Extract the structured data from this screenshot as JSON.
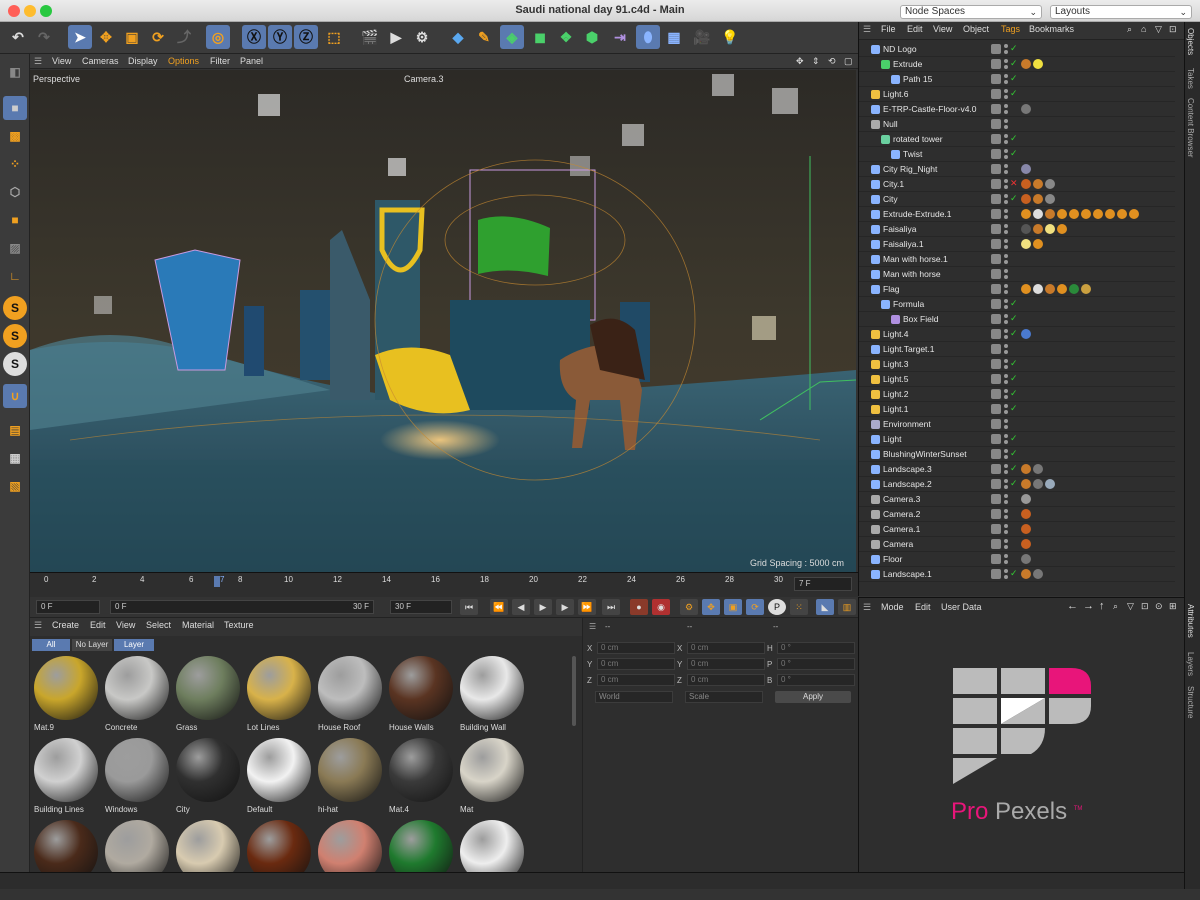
{
  "window": {
    "title": "Saudi national day 91.c4d - Main",
    "node_spaces": "Node Spaces",
    "layouts": "Layouts"
  },
  "viewport": {
    "menu": [
      "View",
      "Cameras",
      "Display",
      "Options",
      "Filter",
      "Panel"
    ],
    "label": "Perspective",
    "camera": "Camera.3",
    "grid": "Grid Spacing : 5000 cm"
  },
  "timeline": {
    "ticks": [
      "0",
      "2",
      "4",
      "6",
      "7",
      "8",
      "10",
      "12",
      "14",
      "16",
      "18",
      "20",
      "22",
      "24",
      "26",
      "28",
      "30"
    ],
    "current": "7 F",
    "start": "0 F",
    "range_start": "0 F",
    "range_end": "30 F",
    "end": "30 F"
  },
  "materials": {
    "menu": [
      "Create",
      "Edit",
      "View",
      "Select",
      "Material",
      "Texture"
    ],
    "tabs": [
      "All",
      "No Layer",
      "Layer"
    ],
    "items": [
      {
        "name": "Mat.9",
        "color": "#c9a62b"
      },
      {
        "name": "Concrete",
        "color": "#c8c8c6"
      },
      {
        "name": "Grass",
        "color": "#6e7e5e"
      },
      {
        "name": "Lot Lines",
        "color": "#d8b24a"
      },
      {
        "name": "House Roof",
        "color": "#bdbdbd"
      },
      {
        "name": "House Walls",
        "color": "#5a3422"
      },
      {
        "name": "Building Wall",
        "color": "#e8e8e8"
      },
      {
        "name": "Building Lines",
        "color": "#d0d0d0"
      },
      {
        "name": "Windows",
        "color": "#9a9a9a"
      },
      {
        "name": "City",
        "color": "#303030"
      },
      {
        "name": "Default",
        "color": "#f2f2f2"
      },
      {
        "name": "hi-hat",
        "color": "#8a7a55"
      },
      {
        "name": "Mat.4",
        "color": "#3a3a3a"
      },
      {
        "name": "Mat",
        "color": "#d8d4c8"
      },
      {
        "name": "",
        "color": "#4a2a1a"
      },
      {
        "name": "",
        "color": "#b0aaa0"
      },
      {
        "name": "",
        "color": "#d8cbb0"
      },
      {
        "name": "",
        "color": "#6a2a10"
      },
      {
        "name": "",
        "color": "#d08070"
      },
      {
        "name": "",
        "color": "#1f7a2e"
      },
      {
        "name": "",
        "color": "#eeeeee"
      }
    ]
  },
  "coords": {
    "dash": "--",
    "rows": [
      {
        "a": "X",
        "av": "0 cm",
        "b": "X",
        "bv": "0 cm",
        "c": "H",
        "cv": "0 °"
      },
      {
        "a": "Y",
        "av": "0 cm",
        "b": "Y",
        "bv": "0 cm",
        "c": "P",
        "cv": "0 °"
      },
      {
        "a": "Z",
        "av": "0 cm",
        "b": "Z",
        "bv": "0 cm",
        "c": "B",
        "cv": "0 °"
      }
    ],
    "world": "World",
    "scale": "Scale",
    "apply": "Apply"
  },
  "objects": {
    "menu": [
      "File",
      "Edit",
      "View",
      "Object",
      "Tags",
      "Bookmarks"
    ],
    "rows": [
      {
        "name": "ND Logo",
        "indent": 0,
        "icon": "#8ab4ff",
        "state": "ok",
        "tags": []
      },
      {
        "name": "Extrude",
        "indent": 1,
        "icon": "#4ad06a",
        "state": "ok",
        "tags": [
          "#c87a2a",
          "#f0e040"
        ]
      },
      {
        "name": "Path 15",
        "indent": 2,
        "icon": "#8ab4ff",
        "state": "ok",
        "tags": []
      },
      {
        "name": "Light.6",
        "indent": 0,
        "icon": "#f0c040",
        "state": "ok",
        "tags": []
      },
      {
        "name": "E-TRP-Castle-Floor-v4.0",
        "indent": 0,
        "icon": "#8ab4ff",
        "state": "",
        "tags": [
          "#777"
        ]
      },
      {
        "name": "Null",
        "indent": 0,
        "icon": "#aaa",
        "state": "",
        "tags": []
      },
      {
        "name": "rotated tower",
        "indent": 1,
        "icon": "#6ad0a0",
        "state": "ok",
        "tags": []
      },
      {
        "name": "Twist",
        "indent": 2,
        "icon": "#8ab4ff",
        "state": "ok",
        "tags": []
      },
      {
        "name": "City Rig_Night",
        "indent": 0,
        "icon": "#8ab4ff",
        "state": "",
        "tags": [
          "#88a"
        ]
      },
      {
        "name": "City.1",
        "indent": 0,
        "icon": "#8ab4ff",
        "state": "x",
        "tags": [
          "#c86020",
          "#c87a2a",
          "#888"
        ]
      },
      {
        "name": "City",
        "indent": 0,
        "icon": "#8ab4ff",
        "state": "ok",
        "tags": [
          "#c86020",
          "#c87a2a",
          "#888"
        ]
      },
      {
        "name": "Extrude-Extrude.1",
        "indent": 0,
        "icon": "#8ab4ff",
        "state": "",
        "tags": [
          "#e09020",
          "#ddd",
          "#c87a2a",
          "#e09020",
          "#e09020",
          "#e09020",
          "#e09020",
          "#e09020",
          "#e09020",
          "#e09020"
        ]
      },
      {
        "name": "Faisaliya",
        "indent": 0,
        "icon": "#8ab4ff",
        "state": "",
        "tags": [
          "#555",
          "#c87a2a",
          "#f0e080",
          "#e09020"
        ]
      },
      {
        "name": "Faisaliya.1",
        "indent": 0,
        "icon": "#8ab4ff",
        "state": "",
        "tags": [
          "#f0e080",
          "#e09020"
        ]
      },
      {
        "name": "Man with horse.1",
        "indent": 0,
        "icon": "#8ab4ff",
        "state": "",
        "tags": []
      },
      {
        "name": "Man with horse",
        "indent": 0,
        "icon": "#8ab4ff",
        "state": "",
        "tags": []
      },
      {
        "name": "Flag",
        "indent": 0,
        "icon": "#8ab4ff",
        "state": "",
        "tags": [
          "#e09020",
          "#ddd",
          "#c87a2a",
          "#e09020",
          "#2a8a3a",
          "#caa040"
        ]
      },
      {
        "name": "Formula",
        "indent": 1,
        "icon": "#8ab4ff",
        "state": "ok",
        "tags": []
      },
      {
        "name": "Box Field",
        "indent": 2,
        "icon": "#b090e0",
        "state": "ok",
        "tags": []
      },
      {
        "name": "Light.4",
        "indent": 0,
        "icon": "#f0c040",
        "state": "ok",
        "tags": [
          "#4a7ad0"
        ]
      },
      {
        "name": "Light.Target.1",
        "indent": 0,
        "icon": "#8ab4ff",
        "state": "",
        "tags": []
      },
      {
        "name": "Light.3",
        "indent": 0,
        "icon": "#f0c040",
        "state": "ok",
        "tags": []
      },
      {
        "name": "Light.5",
        "indent": 0,
        "icon": "#f0c040",
        "state": "ok",
        "tags": []
      },
      {
        "name": "Light.2",
        "indent": 0,
        "icon": "#f0c040",
        "state": "ok",
        "tags": []
      },
      {
        "name": "Light.1",
        "indent": 0,
        "icon": "#f0c040",
        "state": "ok",
        "tags": []
      },
      {
        "name": "Environment",
        "indent": 0,
        "icon": "#aac",
        "state": "",
        "tags": []
      },
      {
        "name": "Light",
        "indent": 0,
        "icon": "#8ab4ff",
        "state": "ok",
        "tags": []
      },
      {
        "name": "BlushingWinterSunset",
        "indent": 0,
        "icon": "#8ab4ff",
        "state": "ok",
        "tags": []
      },
      {
        "name": "Landscape.3",
        "indent": 0,
        "icon": "#8ab4ff",
        "state": "ok",
        "tags": [
          "#c87a2a",
          "#777"
        ]
      },
      {
        "name": "Landscape.2",
        "indent": 0,
        "icon": "#8ab4ff",
        "state": "ok",
        "tags": [
          "#c87a2a",
          "#777",
          "#9ab"
        ]
      },
      {
        "name": "Camera.3",
        "indent": 0,
        "icon": "#aaa",
        "state": "",
        "tags": [
          "#999"
        ]
      },
      {
        "name": "Camera.2",
        "indent": 0,
        "icon": "#aaa",
        "state": "",
        "tags": [
          "#c86020"
        ]
      },
      {
        "name": "Camera.1",
        "indent": 0,
        "icon": "#aaa",
        "state": "",
        "tags": [
          "#c86020"
        ]
      },
      {
        "name": "Camera",
        "indent": 0,
        "icon": "#aaa",
        "state": "",
        "tags": [
          "#c86020"
        ]
      },
      {
        "name": "Floor",
        "indent": 0,
        "icon": "#8ab4ff",
        "state": "",
        "tags": [
          "#777"
        ]
      },
      {
        "name": "Landscape.1",
        "indent": 0,
        "icon": "#8ab4ff",
        "state": "ok",
        "tags": [
          "#c87a2a",
          "#777"
        ]
      }
    ]
  },
  "attributes": {
    "menu": [
      "Mode",
      "Edit",
      "User Data"
    ]
  },
  "logo": {
    "text_a": "Pro",
    "text_b": "Pexels",
    "tm": "TM"
  },
  "sidebar": {
    "top": [
      "Objects",
      "Takes",
      "Content Browser"
    ],
    "bottom": [
      "Attributes",
      "Layers",
      "Structure"
    ]
  }
}
